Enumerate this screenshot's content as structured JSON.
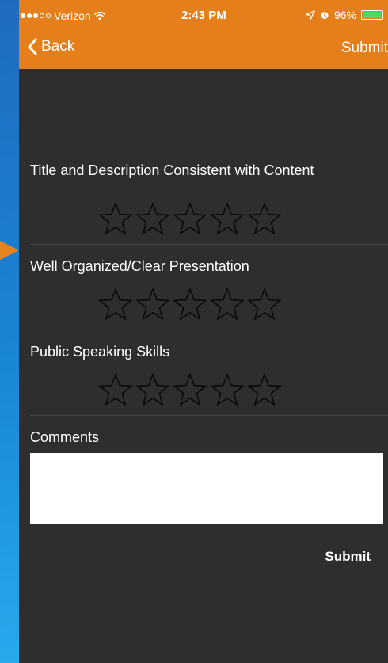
{
  "status_bar": {
    "carrier": "Verizon",
    "signal_bars_filled": 3,
    "signal_bars_total": 5,
    "time": "2:43 PM",
    "battery": "96%",
    "battery_level": 0.96
  },
  "nav": {
    "back_label": "Back",
    "submit_label": "Submit"
  },
  "ratings": [
    {
      "label": "Title and Description Consistent with Content",
      "stars_total": 5,
      "stars_selected": 0
    },
    {
      "label": "Well Organized/Clear Presentation",
      "stars_total": 5,
      "stars_selected": 0
    },
    {
      "label": "Public Speaking Skills",
      "stars_total": 5,
      "stars_selected": 0
    }
  ],
  "comments": {
    "label": "Comments",
    "value": ""
  },
  "footer": {
    "submit_label": "Submit"
  },
  "colors": {
    "accent": "#e57f1b",
    "background": "#2e2e2e",
    "outer_background": "#1a86d6"
  }
}
